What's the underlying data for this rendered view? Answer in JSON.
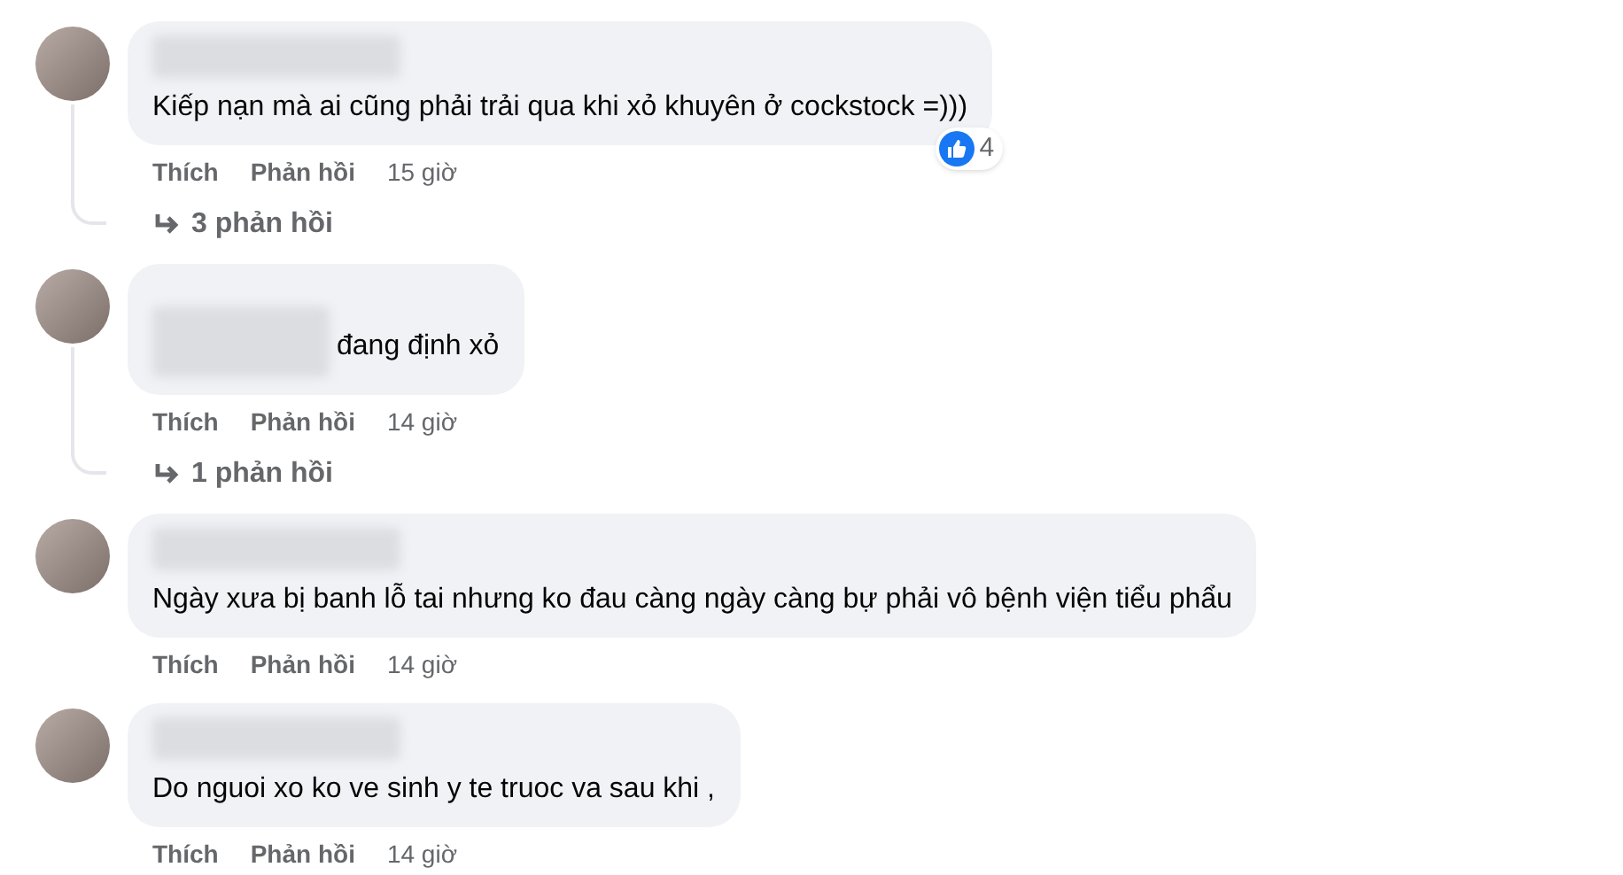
{
  "comments": [
    {
      "text": "Kiếp nạn mà ai cũng phải trải qua khi xỏ khuyên ở cockstock =)))",
      "inline_mention": false,
      "like": "Thích",
      "reply": "Phản hồi",
      "time": "15 giờ",
      "reaction_count": "4",
      "replies": "3 phản hồi"
    },
    {
      "text": "đang định xỏ",
      "inline_mention": true,
      "like": "Thích",
      "reply": "Phản hồi",
      "time": "14 giờ",
      "replies": "1 phản hồi"
    },
    {
      "text": "Ngày xưa bị banh lỗ tai nhưng ko đau càng ngày càng bự phải vô bệnh viện tiểu phẩu",
      "inline_mention": false,
      "like": "Thích",
      "reply": "Phản hồi",
      "time": "14 giờ"
    },
    {
      "text": "Do nguoi xo ko ve sinh y te truoc va sau khi ,",
      "inline_mention": false,
      "like": "Thích",
      "reply": "Phản hồi",
      "time": "14 giờ"
    }
  ]
}
